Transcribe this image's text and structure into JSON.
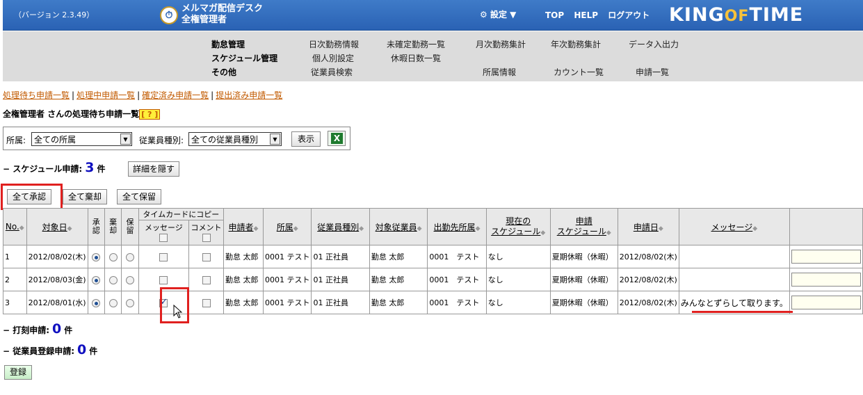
{
  "header": {
    "version": "（バージョン 2.3.49）",
    "app_line1": "メルマガ配信デスク",
    "app_line2": "全権管理者",
    "settings": "設定",
    "top": "TOP",
    "help": "HELP",
    "logout": "ログアウト",
    "logo_king": "KING",
    "logo_of": "OF",
    "logo_time": "TIME"
  },
  "menu": {
    "categories": [
      "勤怠管理",
      "スケジュール管理",
      "その他"
    ],
    "row1": [
      "日次勤務情報",
      "未確定勤務一覧",
      "月次勤務集計",
      "年次勤務集計",
      "データ入出力"
    ],
    "row2": [
      "個人別設定",
      "休暇日数一覧"
    ],
    "row3": [
      "従業員検索",
      "所属情報",
      "カウント一覧",
      "申請一覧"
    ]
  },
  "sublinks": [
    "処理待ち申請一覧",
    "処理中申請一覧",
    "確定済み申請一覧",
    "提出済み申請一覧"
  ],
  "page_title": "全権管理者 さんの処理待ち申請一覧",
  "help_badge": "[ ? ]",
  "filter": {
    "affiliation_label": "所属:",
    "affiliation_value": "全ての所属",
    "emp_type_label": "従業員種別:",
    "emp_type_value": "全ての従業員種別",
    "show_button": "表示"
  },
  "schedule_section": {
    "label": "− スケジュール申請:",
    "count": "3",
    "unit": "件",
    "hide_button": "詳細を隠す"
  },
  "bulk_buttons": [
    "全て承認",
    "全て棄却",
    "全て保留"
  ],
  "table": {
    "copy_group": "タイムカードにコピー",
    "copy_message": "メッセージ",
    "copy_comment": "コメント",
    "headers": {
      "no": "No.",
      "date": "対象日",
      "approve": "承認",
      "reject": "棄却",
      "hold": "保留",
      "applicant": "申請者",
      "affiliation": "所属",
      "emp_type": "従業員種別",
      "target_emp": "対象従業員",
      "dest": "出勤先所属",
      "current_sched_1": "現在の",
      "current_sched_2": "スケジュール",
      "req_sched_1": "申請",
      "req_sched_2": "スケジュール",
      "req_date": "申請日",
      "message": "メッセージ"
    },
    "rows": [
      {
        "no": "1",
        "date": "2012/08/02(木)",
        "msg_copy": false,
        "applicant": "勤怠 太郎",
        "affiliation": "0001 テスト",
        "emp_type": "01 正社員",
        "target": "勤怠 太郎",
        "dest": "0001　テスト",
        "current": "なし",
        "requested": "夏期休暇（休暇）",
        "req_date": "2012/08/02(木)",
        "message": ""
      },
      {
        "no": "2",
        "date": "2012/08/03(金)",
        "msg_copy": false,
        "applicant": "勤怠 太郎",
        "affiliation": "0001 テスト",
        "emp_type": "01 正社員",
        "target": "勤怠 太郎",
        "dest": "0001　テスト",
        "current": "なし",
        "requested": "夏期休暇（休暇）",
        "req_date": "2012/08/02(木)",
        "message": ""
      },
      {
        "no": "3",
        "date": "2012/08/01(水)",
        "msg_copy": true,
        "applicant": "勤怠 太郎",
        "affiliation": "0001 テスト",
        "emp_type": "01 正社員",
        "target": "勤怠 太郎",
        "dest": "0001　テスト",
        "current": "なし",
        "requested": "夏期休暇（休暇）",
        "req_date": "2012/08/02(木)",
        "message": "みんなとずらして取ります。"
      }
    ]
  },
  "punch_section": {
    "label": "− 打刻申請:",
    "count": "0",
    "unit": "件"
  },
  "employee_section": {
    "label": "− 従業員登録申請:",
    "count": "0",
    "unit": "件"
  },
  "register_button": "登録"
}
